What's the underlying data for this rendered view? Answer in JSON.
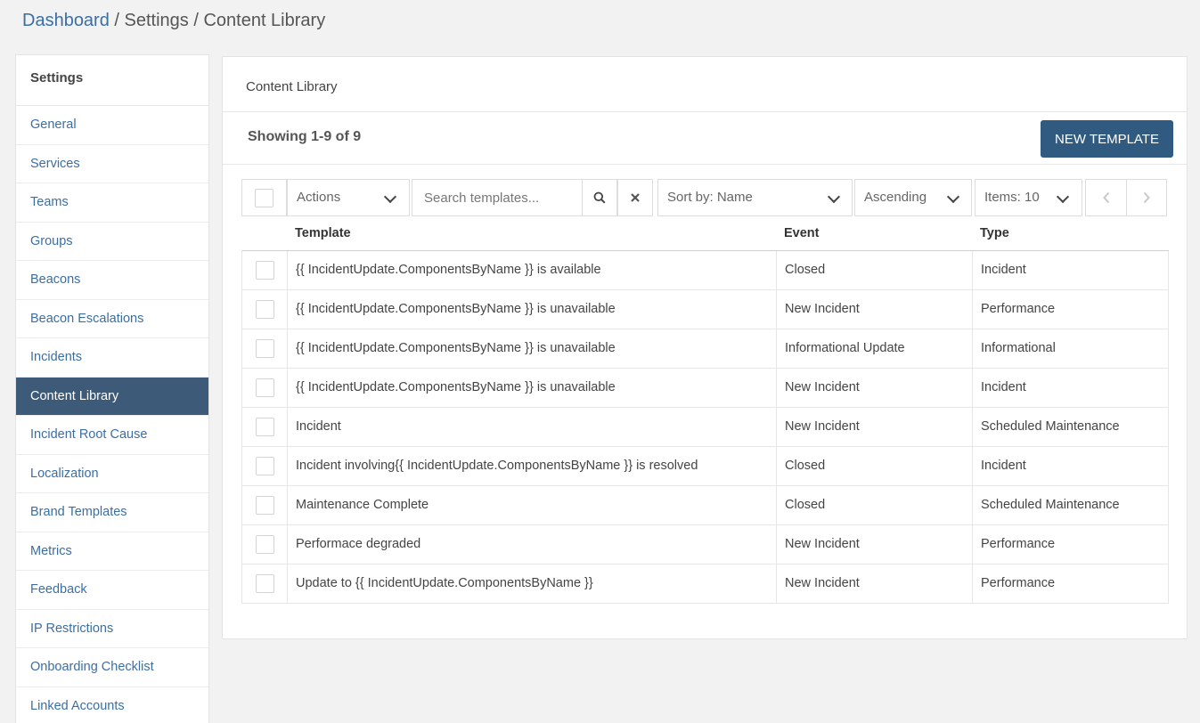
{
  "breadcrumb": {
    "home": "Dashboard",
    "separator": " / ",
    "settings": "Settings",
    "current": "Content Library"
  },
  "sidebar": {
    "title": "Settings",
    "items": [
      {
        "label": "General"
      },
      {
        "label": "Services"
      },
      {
        "label": "Teams"
      },
      {
        "label": "Groups"
      },
      {
        "label": "Beacons"
      },
      {
        "label": "Beacon Escalations"
      },
      {
        "label": "Incidents"
      },
      {
        "label": "Content Library",
        "active": true
      },
      {
        "label": "Incident Root Cause"
      },
      {
        "label": "Localization"
      },
      {
        "label": "Brand Templates"
      },
      {
        "label": "Metrics"
      },
      {
        "label": "Feedback"
      },
      {
        "label": "IP Restrictions"
      },
      {
        "label": "Onboarding Checklist"
      },
      {
        "label": "Linked Accounts"
      }
    ]
  },
  "panel": {
    "title": "Content Library",
    "showing": "Showing 1-9 of 9",
    "new_button": "NEW TEMPLATE"
  },
  "toolbar": {
    "actions": "Actions",
    "search_placeholder": "Search templates...",
    "sort": "Sort by: Name",
    "order": "Ascending",
    "items": "Items: 10"
  },
  "table": {
    "headers": {
      "template": "Template",
      "event": "Event",
      "type": "Type"
    },
    "rows": [
      {
        "template": "{{ IncidentUpdate.ComponentsByName }} is available",
        "event": "Closed",
        "type": "Incident"
      },
      {
        "template": "{{ IncidentUpdate.ComponentsByName }} is unavailable",
        "event": "New Incident",
        "type": "Performance"
      },
      {
        "template": "{{ IncidentUpdate.ComponentsByName }} is unavailable",
        "event": "Informational Update",
        "type": "Informational"
      },
      {
        "template": "{{ IncidentUpdate.ComponentsByName }} is unavailable",
        "event": "New Incident",
        "type": "Incident"
      },
      {
        "template": "Incident",
        "event": "New Incident",
        "type": "Scheduled Maintenance"
      },
      {
        "template": "Incident involving{{ IncidentUpdate.ComponentsByName }} is resolved",
        "event": "Closed",
        "type": "Incident"
      },
      {
        "template": "Maintenance Complete",
        "event": "Closed",
        "type": "Scheduled Maintenance"
      },
      {
        "template": "Performace degraded",
        "event": "New Incident",
        "type": "Performance"
      },
      {
        "template": "Update to {{ IncidentUpdate.ComponentsByName }}",
        "event": "New Incident",
        "type": "Performance"
      }
    ]
  },
  "colors": {
    "accent": "#315a80",
    "sidebar_active": "#3d5a78",
    "link": "#3a6ea5"
  }
}
